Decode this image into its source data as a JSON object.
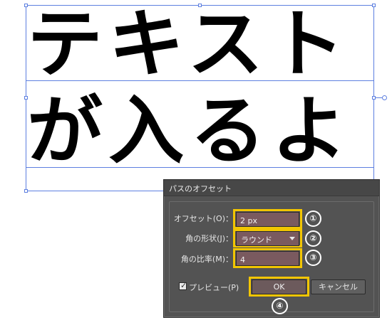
{
  "canvas": {
    "text_line1": "テキスト",
    "text_line2": "が入るよ"
  },
  "dialog": {
    "title": "パスのオフセット",
    "offset_label": "オフセット(O)：",
    "offset_value": "2 px",
    "joins_label": "角の形状(J)：",
    "joins_value": "ラウンド",
    "miter_label": "角の比率(M)：",
    "miter_value": "4",
    "preview_label": "プレビュー(P)",
    "preview_checked": true,
    "ok_label": "OK",
    "cancel_label": "キャンセル"
  },
  "annotations": {
    "n1": "①",
    "n2": "②",
    "n3": "③",
    "n4": "④"
  },
  "colors": {
    "highlight": "#f2c500",
    "selection": "#5d7fe0",
    "dialog_bg": "#535353"
  }
}
